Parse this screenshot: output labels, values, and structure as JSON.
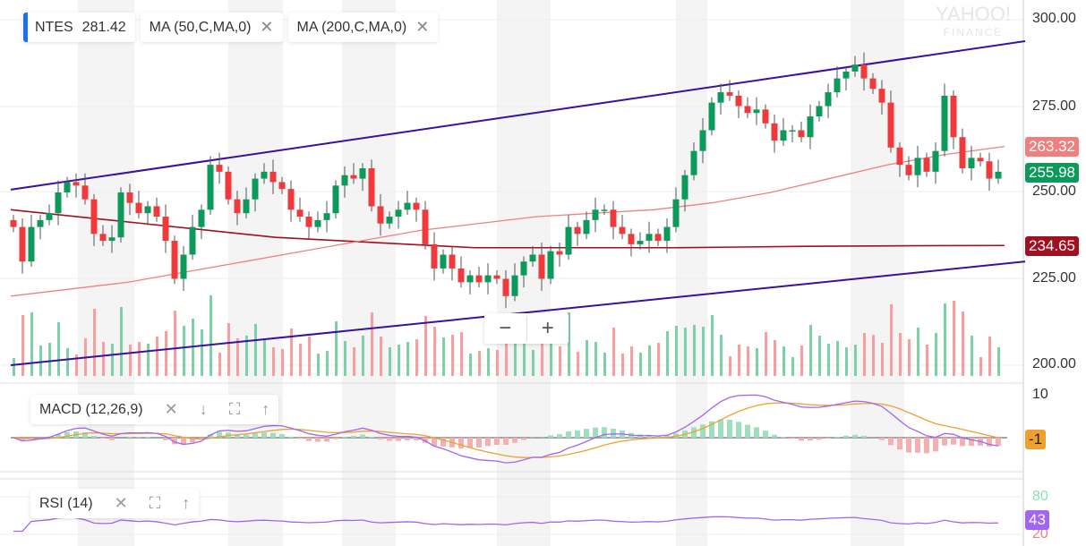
{
  "legend": {
    "symbol": "NTES",
    "price": "281.42",
    "ma50": "MA (50,C,MA,0)",
    "ma200": "MA (200,C,MA,0)",
    "close": "✕"
  },
  "macd": {
    "label": "MACD (12,26,9)",
    "close": "✕",
    "down": "↓",
    "expand": "⛶",
    "up": "↑",
    "tick_10": "10",
    "value": "-1"
  },
  "rsi": {
    "label": "RSI (14)",
    "close": "✕",
    "expand": "⛶",
    "up": "↑",
    "tick_80": "80",
    "tick_20": "20",
    "value": "43"
  },
  "zoom": {
    "minus": "−",
    "plus": "+"
  },
  "logo": {
    "line1": "YAHOO!",
    "line2": "FINANCE"
  },
  "tags": {
    "ma50": "263.32",
    "last": "255.98",
    "ma200": "234.65"
  },
  "colors": {
    "up": "#0c9a5a",
    "down": "#f0393a",
    "ma50": "#f08080",
    "ma200": "#a01020",
    "channel": "#3a10a0",
    "macd": "#a066f0",
    "signal": "#f0a030"
  },
  "chart_data": {
    "type": "candlestick",
    "yticks": [
      "300.00",
      "275.00",
      "250.00",
      "225.00",
      "200.00"
    ],
    "ylim": [
      200,
      300
    ],
    "closes": [
      240,
      230,
      240,
      242,
      244,
      250,
      253,
      252,
      248,
      238,
      236,
      237,
      250,
      247,
      244,
      246,
      243,
      236,
      225,
      232,
      240,
      245,
      258,
      256,
      248,
      244,
      248,
      254,
      256,
      253,
      251,
      245,
      243,
      240,
      242,
      244,
      252,
      255,
      254,
      257,
      246,
      241,
      243,
      245,
      247,
      245,
      235,
      228,
      232,
      228,
      224,
      226,
      224,
      226,
      225,
      220,
      226,
      230,
      232,
      225,
      233,
      232,
      240,
      238,
      242,
      245,
      245,
      240,
      238,
      235,
      236,
      238,
      236,
      240,
      248,
      255,
      262,
      268,
      276,
      279,
      278,
      275,
      273,
      274,
      270,
      265,
      268,
      268,
      266,
      272,
      275,
      279,
      283,
      285,
      287,
      283,
      280,
      276,
      263,
      258,
      255,
      260,
      256,
      262,
      278,
      266,
      257,
      260,
      259,
      254,
      256
    ],
    "ma50": [
      220,
      222,
      224,
      227,
      230,
      233,
      236,
      239,
      241,
      243,
      244,
      245,
      247,
      250,
      254,
      258,
      261,
      263.32
    ],
    "ma200": [
      245,
      243,
      241,
      239,
      237,
      236,
      235,
      234,
      234,
      234,
      234,
      234.2,
      234.4,
      234.5,
      234.6,
      234.65
    ],
    "channel_upper": [
      250.8,
      293.8
    ],
    "channel_lower": [
      200,
      230
    ]
  }
}
